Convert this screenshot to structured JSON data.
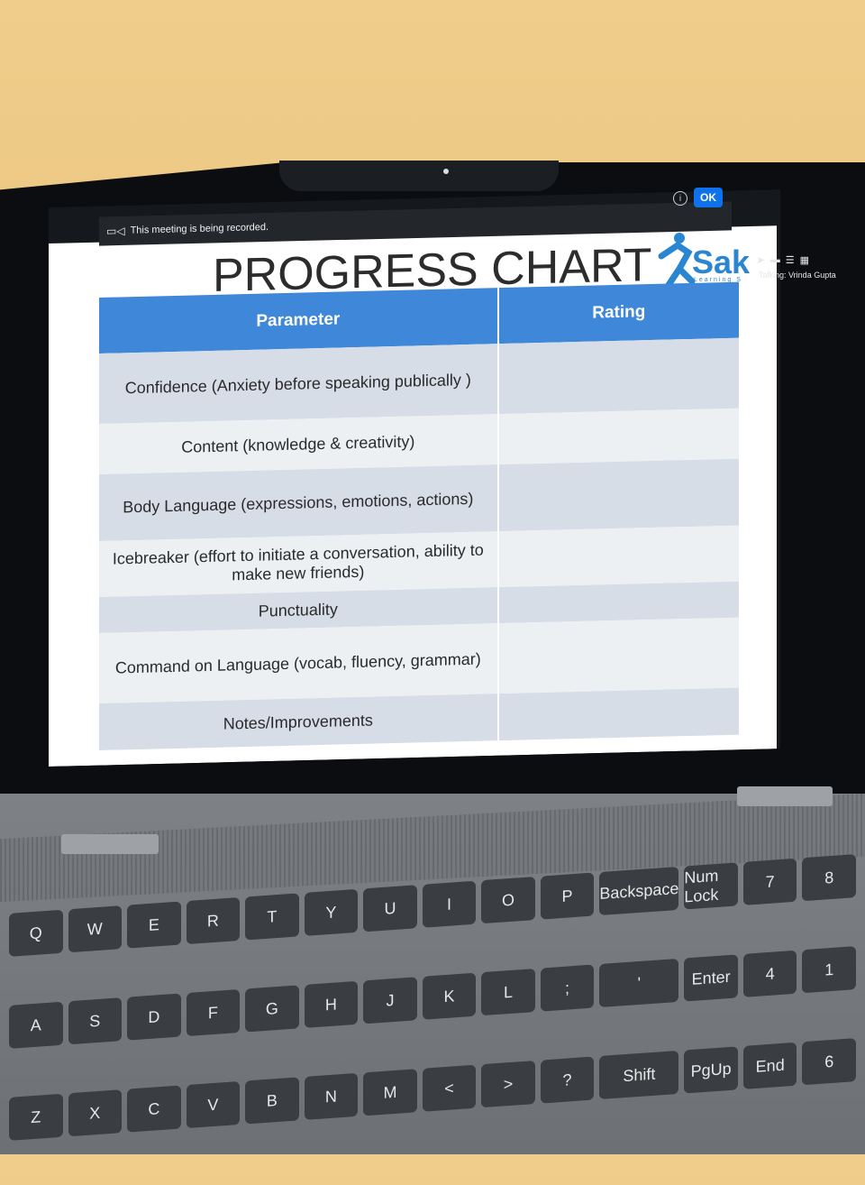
{
  "meeting": {
    "recording_notice": "This meeting is being recorded.",
    "ok_label": "OK",
    "talking_label": "Talking: Vrinda Gupta"
  },
  "slide": {
    "title": "PROGRESS CHART",
    "logo_text": "Sak",
    "logo_subtext": "Learning S",
    "table": {
      "headers": [
        "Parameter",
        "Rating"
      ],
      "rows": [
        {
          "parameter": "Confidence (Anxiety before speaking publically )",
          "rating": ""
        },
        {
          "parameter": "Content (knowledge & creativity)",
          "rating": ""
        },
        {
          "parameter": "Body Language (expressions, emotions, actions)",
          "rating": ""
        },
        {
          "parameter": "Icebreaker (effort to initiate a conversation, ability to make new friends)",
          "rating": ""
        },
        {
          "parameter": "Punctuality",
          "rating": ""
        },
        {
          "parameter": "Command on Language (vocab, fluency, grammar)",
          "rating": ""
        },
        {
          "parameter": "Notes/Improvements",
          "rating": ""
        }
      ]
    }
  },
  "keyboard": {
    "keys": [
      "Q",
      "W",
      "E",
      "R",
      "T",
      "Y",
      "U",
      "I",
      "O",
      "P",
      "Backspace",
      "Num Lock",
      "7",
      "8",
      "A",
      "S",
      "D",
      "F",
      "G",
      "H",
      "J",
      "K",
      "L",
      ";",
      "'",
      "Enter",
      "4",
      "1",
      "Z",
      "X",
      "C",
      "V",
      "B",
      "N",
      "M",
      "<",
      ">",
      "?",
      "Shift",
      "PgUp",
      "End",
      "6"
    ]
  }
}
